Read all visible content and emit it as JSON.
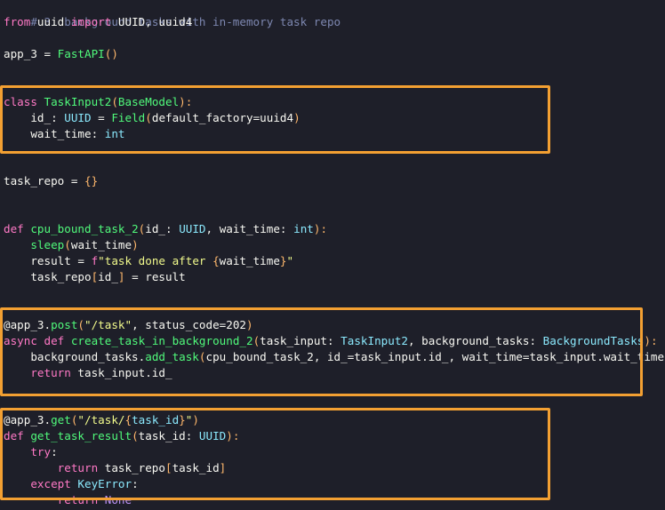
{
  "colors": {
    "background": "#1e1f29",
    "highlight_border": "#f3a032",
    "keyword": "#ff79c6",
    "builtin": "#8be9fd",
    "function": "#50fa7b",
    "string": "#f1fa8c",
    "comment": "#7d87b0"
  },
  "code": {
    "comment": "# 3. background tasks with in-memory task repo",
    "import": {
      "kw1": "from",
      "mod": " uuid ",
      "kw2": "import",
      "names": " UUID, uuid4"
    },
    "app_line": {
      "name": "app_3 = ",
      "call": "FastAPI",
      "paren": "()"
    },
    "class_def": {
      "kw": "class ",
      "name": "TaskInput2",
      "open": "(",
      "base": "BaseModel",
      "close": "):"
    },
    "field_id": {
      "a": "    id_: ",
      "type": "UUID",
      "b": " = ",
      "call": "Field",
      "open": "(",
      "arg": "default_factory=uuid4",
      "close": ")"
    },
    "field_wait": {
      "a": "    wait_time: ",
      "type": "int"
    },
    "repo": {
      "a": "task_repo = ",
      "paren": "{}"
    },
    "def_cpu": {
      "kw": "def ",
      "name": "cpu_bound_task_2",
      "open": "(",
      "a": "id_: ",
      "t1": "UUID",
      "b": ", wait_time: ",
      "t2": "int",
      "close": "):"
    },
    "sleep": {
      "a": "    ",
      "call": "sleep",
      "open": "(",
      "arg": "wait_time",
      "close": ")"
    },
    "result": {
      "a": "    result = ",
      "f": "f",
      "s1": "\"task done after ",
      "b1": "{",
      "v": "wait_time",
      "b2": "}",
      "s2": "\""
    },
    "assign": {
      "a": "    task_repo",
      "open": "[",
      "arg": "id_",
      "close": "]",
      "b": " = result"
    },
    "decor_post": {
      "at": "@app_3.",
      "call": "post",
      "open": "(",
      "str": "\"/task\"",
      "b": ", status_code=",
      "num": "202",
      "close": ")"
    },
    "def_create": {
      "kw1": "async ",
      "kw2": "def ",
      "name": "create_task_in_background_2",
      "open": "(",
      "a": "task_input: ",
      "t1": "TaskInput2",
      "b": ", background_tasks: ",
      "t2": "BackgroundTasks",
      "close": "):"
    },
    "add_task": {
      "a": "    background_tasks.",
      "call": "add_task",
      "open": "(",
      "arg": "cpu_bound_task_2, id_=task_input.id_, wait_time=task_input.wait_time",
      "close": ")"
    },
    "return1": {
      "kw": "    return ",
      "a": "task_input.id_"
    },
    "decor_get": {
      "at": "@app_3.",
      "call": "get",
      "open": "(",
      "s1": "\"/task/",
      "b1": "{",
      "v": "task_id",
      "b2": "}",
      "s2": "\"",
      "close": ")"
    },
    "def_get": {
      "kw": "def ",
      "name": "get_task_result",
      "open": "(",
      "a": "task_id: ",
      "t1": "UUID",
      "close": "):"
    },
    "try": {
      "kw": "    try",
      "colon": ":"
    },
    "return2": {
      "kw": "        return ",
      "a": "task_repo",
      "open": "[",
      "arg": "task_id",
      "close": "]"
    },
    "except": {
      "kw": "    except ",
      "exc": "KeyError",
      "colon": ":"
    },
    "return3": {
      "kw": "        return ",
      "val": "None"
    }
  }
}
